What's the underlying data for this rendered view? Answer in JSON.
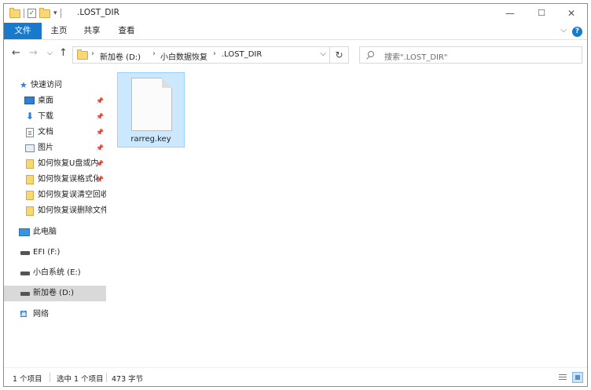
{
  "window": {
    "title": ".LOST_DIR",
    "controls": {
      "minimize": "—",
      "maximize": "☐",
      "close": "✕"
    }
  },
  "ribbon": {
    "tabs": [
      "文件",
      "主页",
      "共享",
      "查看"
    ],
    "help": "?"
  },
  "address": {
    "crumbs": [
      "新加卷 (D:)",
      "小白数据恢复",
      ".LOST_DIR"
    ]
  },
  "search": {
    "placeholder": "搜索\".LOST_DIR\""
  },
  "sidebar": {
    "quick_access": "快速访问",
    "quick_items": [
      {
        "label": "桌面",
        "icon": "desktop-icon"
      },
      {
        "label": "下载",
        "icon": "download-icon"
      },
      {
        "label": "文档",
        "icon": "documents-icon"
      },
      {
        "label": "图片",
        "icon": "pictures-icon"
      },
      {
        "label": "如何恢复U盘或内",
        "icon": "folder-icon"
      },
      {
        "label": "如何恢复误格式化",
        "icon": "folder-icon"
      },
      {
        "label": "如何恢复误清空回收",
        "icon": "folder-icon"
      },
      {
        "label": "如何恢复误删除文件",
        "icon": "folder-icon"
      }
    ],
    "this_pc": "此电脑",
    "drives": [
      {
        "label": "EFI (F:)"
      },
      {
        "label": "小白系统 (E:)"
      },
      {
        "label": "新加卷 (D:)"
      }
    ],
    "network": "网络",
    "pin_icon": "pin-icon"
  },
  "files": [
    {
      "name": "rarreg.key",
      "icon": "file-icon"
    }
  ],
  "status": {
    "count": "1 个项目",
    "selected": "选中 1 个项目",
    "size": "473 字节"
  },
  "colors": {
    "accent": "#1979ca",
    "selection": "#cce8ff",
    "selection_border": "#99d1ff",
    "sidebar_selected": "#d9d9d9"
  }
}
